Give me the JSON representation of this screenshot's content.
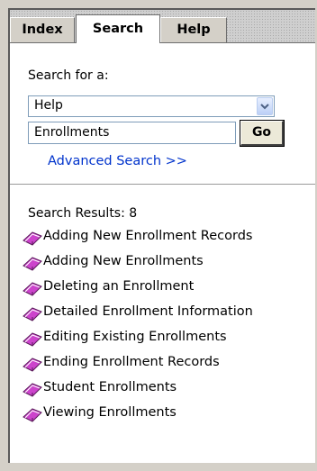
{
  "tabs": [
    {
      "label": "Index"
    },
    {
      "label": "Search"
    },
    {
      "label": "Help"
    }
  ],
  "search": {
    "for_label": "Search for a:",
    "type_selected": "Help",
    "query": "Enrollments",
    "go_label": "Go",
    "advanced_link": "Advanced Search >>"
  },
  "results": {
    "heading": "Search Results: 8",
    "items": [
      {
        "title": "Adding New Enrollment Records"
      },
      {
        "title": "Adding New Enrollments"
      },
      {
        "title": "Deleting an Enrollment"
      },
      {
        "title": "Detailed Enrollment Information"
      },
      {
        "title": "Editing Existing Enrollments"
      },
      {
        "title": "Ending Enrollment Records"
      },
      {
        "title": "Student Enrollments"
      },
      {
        "title": "Viewing Enrollments"
      }
    ]
  },
  "colors": {
    "link": "#0033cc",
    "book_icon": "#cc44cc"
  },
  "icons": {
    "result_item": "book-icon",
    "dropdown": "chevron-down-icon"
  }
}
